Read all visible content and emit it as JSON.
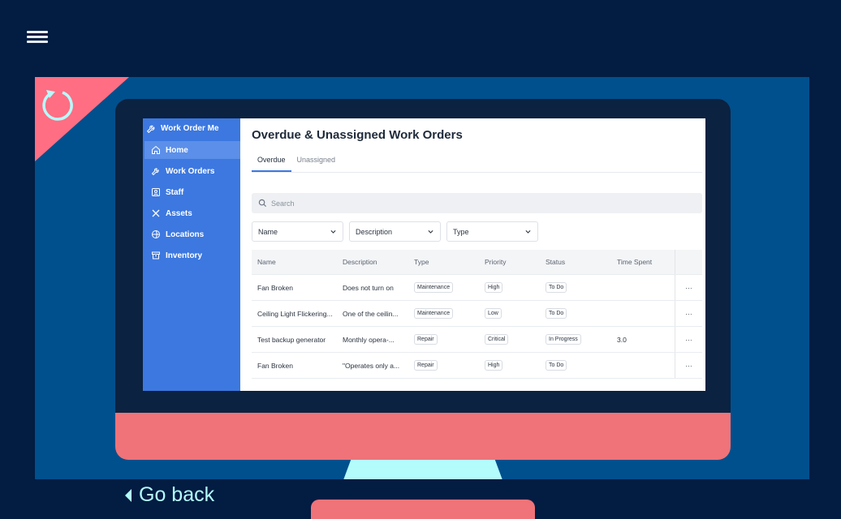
{
  "app": {
    "brand": "Work Order Me",
    "nav": [
      {
        "label": "Home",
        "icon": "home-icon",
        "active": true
      },
      {
        "label": "Work Orders",
        "icon": "wrench-icon"
      },
      {
        "label": "Staff",
        "icon": "staff-icon"
      },
      {
        "label": "Assets",
        "icon": "tools-icon"
      },
      {
        "label": "Locations",
        "icon": "globe-icon"
      },
      {
        "label": "Inventory",
        "icon": "archive-icon"
      }
    ],
    "page_title": "Overdue & Unassigned Work Orders",
    "tabs": [
      {
        "label": "Overdue",
        "active": true
      },
      {
        "label": "Unassigned"
      }
    ],
    "search_placeholder": "Search",
    "filters": [
      "Name",
      "Description",
      "Type"
    ],
    "table": {
      "headers": [
        "Name",
        "Description",
        "Type",
        "Priority",
        "Status",
        "Time Spent"
      ],
      "rows": [
        {
          "name": "Fan Broken",
          "description": "Does not turn on",
          "type": "Maintenance",
          "priority": "High",
          "status": "To Do",
          "time": ""
        },
        {
          "name": "Ceiling Light Flickering...",
          "description": "One of the ceilin...",
          "type": "Maintenance",
          "priority": "Low",
          "status": "To Do",
          "time": ""
        },
        {
          "name": "Test backup generator",
          "description": "Monthly opera-...",
          "type": "Repair",
          "priority": "Critical",
          "status": "In Progress",
          "time": "3.0"
        },
        {
          "name": "Fan Broken",
          "description": "\"Operates only a...",
          "type": "Repair",
          "priority": "High",
          "status": "To Do",
          "time": ""
        }
      ],
      "more_label": "···"
    }
  },
  "go_back_label": "Go back",
  "colors": {
    "background": "#021c42",
    "stage": "#00508d",
    "accent_pink": "#ff6e83",
    "monitor_chin": "#ef7378",
    "stand": "#b4fbfc",
    "sidebar": "#3c78e0"
  }
}
